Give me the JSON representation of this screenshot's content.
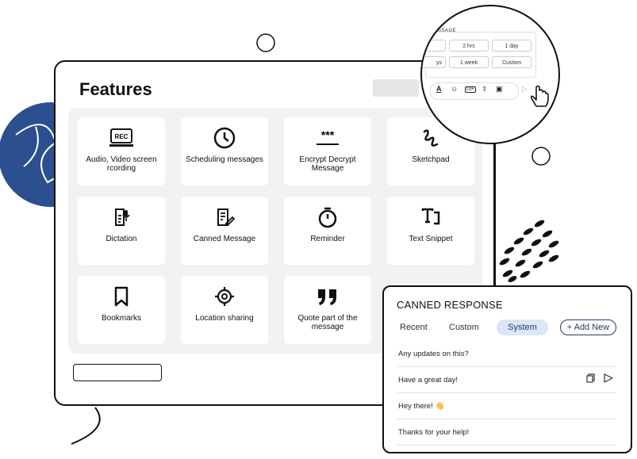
{
  "features": {
    "title": "Features",
    "items": [
      {
        "label": "Audio, Video screen rcording",
        "icon": "rec-monitor-icon",
        "icon_text": "REC"
      },
      {
        "label": "Scheduling messages",
        "icon": "clock-icon"
      },
      {
        "label": "Encrypt Decrypt Message",
        "icon": "asterisks-icon",
        "icon_text": "***"
      },
      {
        "label": "Sketchpad",
        "icon": "squiggle-icon"
      },
      {
        "label": "Dictation",
        "icon": "dictation-icon"
      },
      {
        "label": "Canned Message",
        "icon": "canned-message-icon"
      },
      {
        "label": "Reminder",
        "icon": "stopwatch-icon"
      },
      {
        "label": "Text Snippet",
        "icon": "text-snippet-icon"
      },
      {
        "label": "Bookmarks",
        "icon": "bookmark-icon"
      },
      {
        "label": "Location sharing",
        "icon": "location-target-icon"
      },
      {
        "label": "Quote part of the message",
        "icon": "quote-icon"
      }
    ]
  },
  "schedule_zoom": {
    "header": "MESSAGE",
    "options": [
      "2 hrs",
      "1 day",
      "ys",
      "1 week",
      "Custom"
    ]
  },
  "canned": {
    "title": "CANNED RESPONSE",
    "tabs": [
      "Recent",
      "Custom",
      "System"
    ],
    "active_tab": "System",
    "add_label": "+ Add New",
    "responses": [
      "Any updates on this?",
      "Have a great day!",
      "Hey there! 👋",
      "Thanks for your help!"
    ]
  },
  "colors": {
    "accent_blue": "#2c4f8f",
    "tab_active_bg": "#dbe6f7",
    "tab_active_text": "#1f3b6e"
  }
}
